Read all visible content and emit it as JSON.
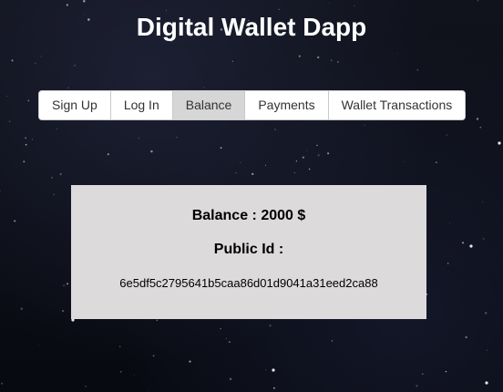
{
  "header": {
    "title": "Digital Wallet Dapp"
  },
  "nav": {
    "items": [
      {
        "label": "Sign Up"
      },
      {
        "label": "Log In"
      },
      {
        "label": "Balance"
      },
      {
        "label": "Payments"
      },
      {
        "label": "Wallet Transactions"
      }
    ],
    "active": "Balance"
  },
  "balance_card": {
    "balance_label": "Balance :",
    "balance_amount": "2000",
    "currency": "$",
    "public_id_label": "Public Id :",
    "public_id_value": "6e5df5c2795641b5caa86d01d9041a31eed2ca88"
  },
  "colors": {
    "background": "#0b0d17",
    "card_background": "#dcdadb",
    "active_tab": "#d6d6d6",
    "title_text": "#ffffff"
  }
}
